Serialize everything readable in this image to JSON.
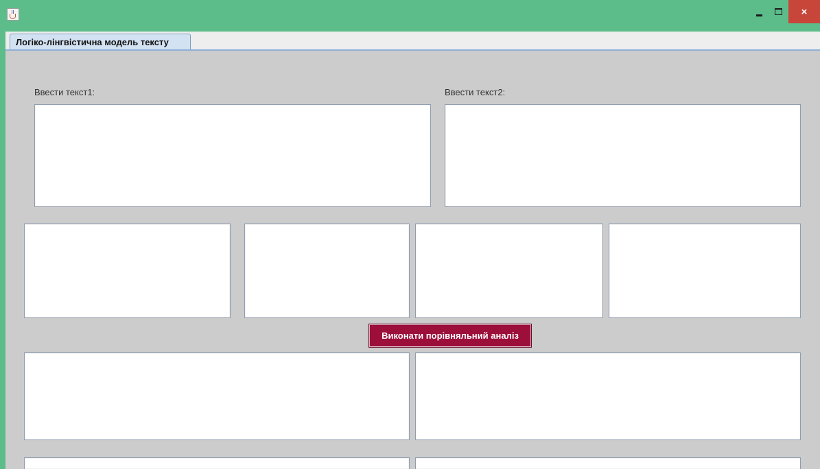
{
  "window": {
    "controls": {
      "minimize": "minimize",
      "maximize": "maximize",
      "close_glyph": "×"
    }
  },
  "tabs": [
    {
      "label": "Логіко-лінгвістична модель тексту",
      "selected": true
    }
  ],
  "form": {
    "text1_label": "Ввести текст1:",
    "text2_label": "Ввести текст2:",
    "text1_value": "",
    "text2_value": ""
  },
  "action_button": {
    "label": "Виконати порівняльний аналіз"
  },
  "colors": {
    "titlebar": "#5cbd8a",
    "close_button": "#c8453a",
    "action_button": "#9c0f3b",
    "panel_background": "#cccccc",
    "tab_selected": "#d3e2f2"
  },
  "icons": {
    "app": "java-app-icon",
    "minimize": "minimize-icon",
    "maximize": "maximize-icon",
    "close": "close-icon"
  }
}
